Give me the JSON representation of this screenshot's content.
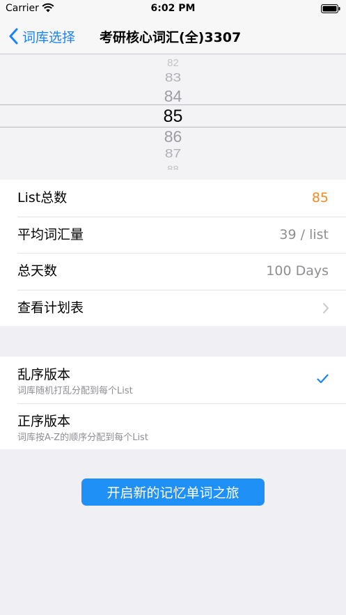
{
  "status_bar": {
    "carrier": "Carrier",
    "time": "6:02 PM"
  },
  "nav": {
    "back_label": "词库选择",
    "title": "考研核心词汇(全)3307"
  },
  "picker": {
    "items": [
      "82",
      "83",
      "84",
      "85",
      "86",
      "87",
      "88"
    ],
    "selected": "85"
  },
  "stats": [
    {
      "label": "List总数",
      "value": "85"
    },
    {
      "label": "平均词汇量",
      "value": "39 / list"
    },
    {
      "label": "总天数",
      "value": "100 Days"
    },
    {
      "label": "查看计划表"
    }
  ],
  "order_options": [
    {
      "title": "乱序版本",
      "subtitle": "词库随机打乱分配到每个List",
      "checked": true
    },
    {
      "title": "正序版本",
      "subtitle": "词库按A-Z的顺序分配到每个List",
      "checked": false
    }
  ],
  "start_button": {
    "label": "开启新的记忆单词之旅"
  },
  "colors": {
    "tint": "#1A82FB",
    "accent": "#F18A24",
    "button": "#1F90F6",
    "background": "#EFEFF4"
  }
}
